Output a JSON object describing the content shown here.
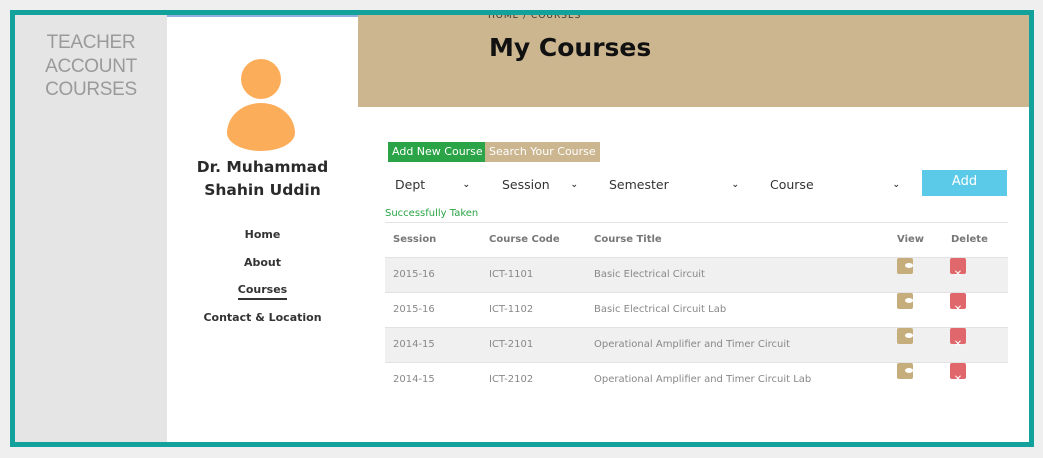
{
  "left_rail": {
    "lines": [
      "TEACHER",
      "ACCOUNT",
      "COURSES"
    ]
  },
  "profile": {
    "name_line1": "Dr. Muhammad",
    "name_line2": "Shahin Uddin",
    "nav": [
      {
        "label": "Home",
        "active": false
      },
      {
        "label": "About",
        "active": false
      },
      {
        "label": "Courses",
        "active": true
      },
      {
        "label": "Contact & Location",
        "active": false
      }
    ]
  },
  "banner": {
    "title": "My Courses",
    "breadcrumb": "HOME / COURSES"
  },
  "actions": {
    "add_new_course": "Add New Course",
    "search_course": "Search Your Course"
  },
  "filters": {
    "dept": "Dept",
    "session": "Session",
    "semester": "Semester",
    "course": "Course",
    "add": "Add"
  },
  "status": "Successfully Taken",
  "table": {
    "headers": [
      "Session",
      "Course Code",
      "Course Title",
      "View",
      "Delete"
    ],
    "rows": [
      {
        "session": "2015-16",
        "code": "ICT-1101",
        "title": "Basic Electrical Circuit"
      },
      {
        "session": "2015-16",
        "code": "ICT-1102",
        "title": "Basic Electrical Circuit Lab"
      },
      {
        "session": "2014-15",
        "code": "ICT-2101",
        "title": "Operational Amplifier and Timer Circuit"
      },
      {
        "session": "2014-15",
        "code": "ICT-2102",
        "title": "Operational Amplifier and Timer Circuit Lab"
      }
    ]
  },
  "colors": {
    "frame": "#13a19b",
    "banner": "#cbb690",
    "green": "#2aa446",
    "add_button": "#5bc9e8",
    "delete": "#e0686c",
    "avatar": "#fcad5a"
  }
}
